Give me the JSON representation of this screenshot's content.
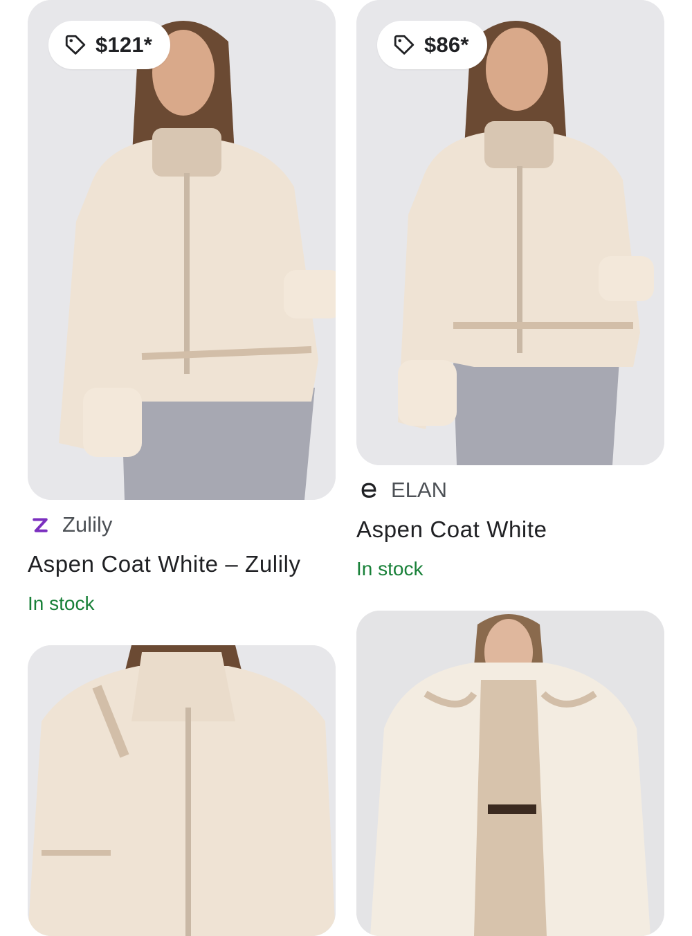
{
  "products": [
    {
      "price": "$121*",
      "seller": "Zulily",
      "title": "Aspen Coat White – Zulily",
      "availability": "In stock",
      "seller_logo": "zulily-z-logo"
    },
    {
      "price": "$86*",
      "seller": "ELAN",
      "title": "Aspen Coat White",
      "availability": "In stock",
      "seller_logo": "elan-e-logo"
    },
    {
      "image": "product-image-hooded-sherpa-jacket"
    },
    {
      "image": "product-image-sherpa-jacket-model"
    }
  ],
  "colors": {
    "stock_green": "#188038",
    "seller_grey": "#4d5156",
    "title_dark": "#202124",
    "zulily_purple": "#7b2fbf"
  },
  "icons": [
    "price-tag-icon"
  ]
}
